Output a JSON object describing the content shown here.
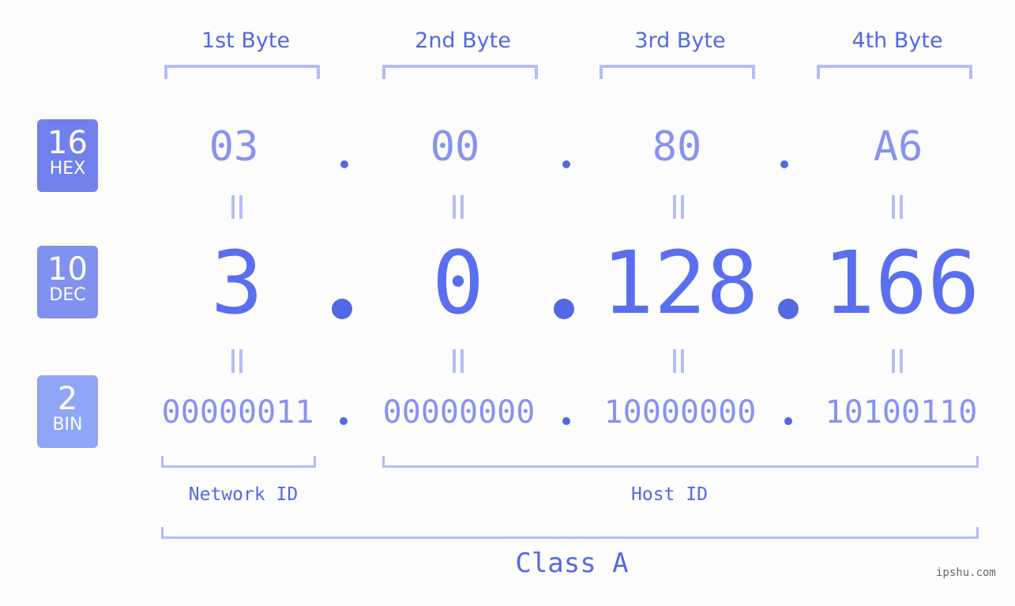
{
  "byte_headers": [
    "1st Byte",
    "2nd Byte",
    "3rd Byte",
    "4th Byte"
  ],
  "badges": [
    {
      "number": "16",
      "label": "HEX",
      "color": "#7180ec"
    },
    {
      "number": "10",
      "label": "DEC",
      "color": "#8191f0"
    },
    {
      "number": "2",
      "label": "BIN",
      "color": "#8fa6f7"
    }
  ],
  "hex": [
    "03",
    "00",
    "80",
    "A6"
  ],
  "dec": [
    "3",
    "0",
    "128",
    "166"
  ],
  "bin": [
    "00000011",
    "00000000",
    "10000000",
    "10100110"
  ],
  "separator": ".",
  "equals_symbol": "=",
  "network_id_label": "Network ID",
  "host_id_label": "Host ID",
  "class_label": "Class A",
  "watermark": "ipshu.com",
  "colors": {
    "accent": "#5468e4",
    "light_value": "#8793ee",
    "bracket": "#b3bdf8",
    "background": "#fcfdfc"
  }
}
